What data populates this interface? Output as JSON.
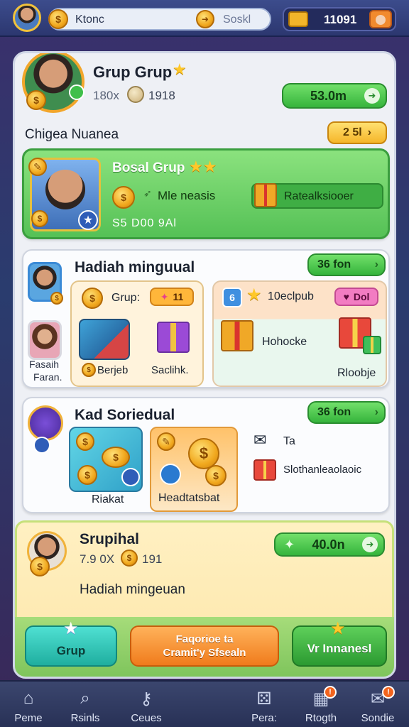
{
  "topbar": {
    "search_label": "Ktonc",
    "search_right_label": "Soskl",
    "score": "11091"
  },
  "profile": {
    "name": "Grup Grup",
    "sub_left": "180x",
    "sub_right": "1918",
    "balance_button": "53.0m",
    "section_label": "Chigea Nuanea",
    "section_badge": "2 5l"
  },
  "social_card": {
    "title": "Bosal Grup",
    "coin_text": "Mle neasis",
    "reward_label": "Ratealksiooer",
    "footer": "S5 D00 9Al"
  },
  "weekly": {
    "title": "Hadiah minguual",
    "button": "36 fon",
    "side_label_1": "Fasaih",
    "side_label_2": "Faran.",
    "grup_label": "Grup:",
    "grup_badge": "11",
    "item_left": "Berjeb",
    "item_right": "Saclihk.",
    "box_label": "10eclpub",
    "box_badge": "Dol",
    "gift_label": "Hohocke",
    "gift_footer": "Rloobje"
  },
  "kad": {
    "title": "Kad Soriedual",
    "button": "36 fon",
    "tile_1": "Riakat",
    "tile_2": "Headtatsbat",
    "side_1": "Ta",
    "side_2": "Slothanleaolaoic"
  },
  "special": {
    "title": "Srupihal",
    "sub_left": "7.9 0X",
    "sub_right": "191",
    "button": "40.0n",
    "subtitle": "Hadiah mingeuan"
  },
  "actions": {
    "grup": "Grup",
    "orange_line1": "Faqorioe ta",
    "orange_line2": "Cramit'y Sfsealn",
    "green": "Vr Innanesl"
  },
  "nav": [
    {
      "label": "Peme"
    },
    {
      "label": "Rsinls"
    },
    {
      "label": "Ceues"
    },
    {
      "label": "Pera:"
    },
    {
      "label": "Rtogth"
    },
    {
      "label": "Sondie"
    }
  ]
}
